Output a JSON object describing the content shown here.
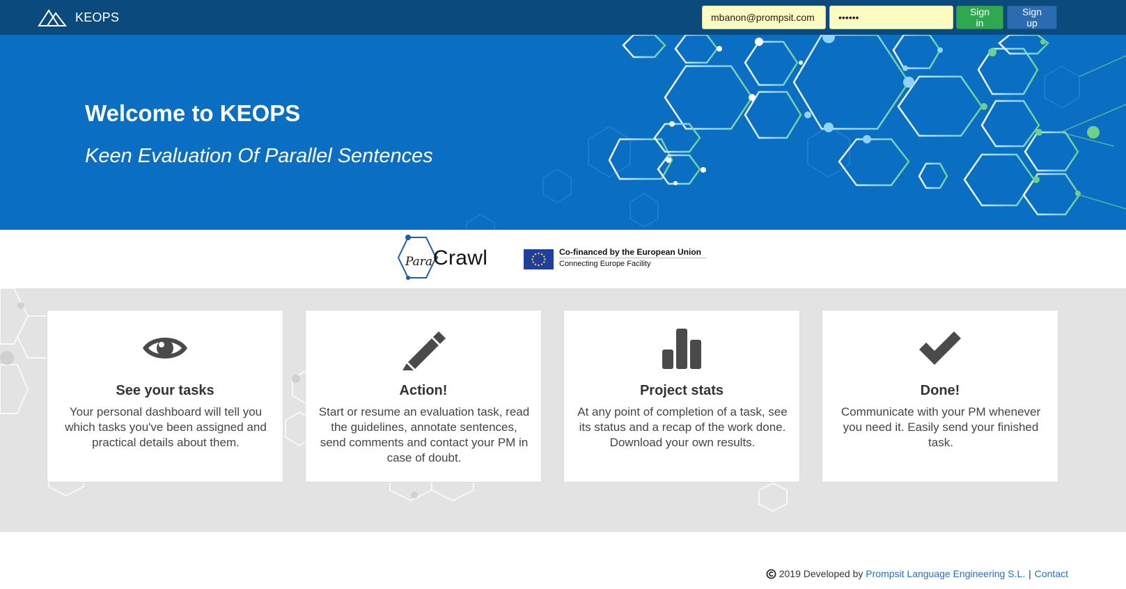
{
  "navbar": {
    "brand": "KEOPS",
    "email_value": "mbanon@prompsit.com",
    "password_value": "••••••",
    "signin_label": "Sign in",
    "signup_label": "Sign up"
  },
  "hero": {
    "title": "Welcome to KEOPS",
    "subtitle": "Keen Evaluation Of Parallel Sentences"
  },
  "sponsors": {
    "paracrawl_para": "Para",
    "paracrawl_crawl": "Crawl",
    "eu_line1": "Co-financed by the European Union",
    "eu_line2": "Connecting Europe Facility"
  },
  "features": [
    {
      "icon": "eye-icon",
      "title": "See your tasks",
      "text": "Your personal dashboard will tell you which tasks you've been assigned and practical details about them."
    },
    {
      "icon": "pencil-icon",
      "title": "Action!",
      "text": "Start or resume an evaluation task, read the guidelines, annotate sentences, send comments and contact your PM in case of doubt."
    },
    {
      "icon": "bar-chart-icon",
      "title": "Project stats",
      "text": "At any point of completion of a task, see its status and a recap of the work done. Download your own results."
    },
    {
      "icon": "checkmark-icon",
      "title": "Done!",
      "text": "Communicate with your PM whenever you need it. Easily send your finished task."
    }
  ],
  "footer": {
    "text": "2019 Developed by",
    "company_link": "Prompsit Language Engineering S.L.",
    "separator": "|",
    "contact_link": "Contact"
  },
  "colors": {
    "navbar": "#0b4a7d",
    "hero": "#0a6fc2",
    "signin": "#2fa84f",
    "signup": "#2b6cb0",
    "input_bg": "#fbfbc2",
    "link": "#2a6fbd",
    "features_bg": "#e3e3e3"
  }
}
